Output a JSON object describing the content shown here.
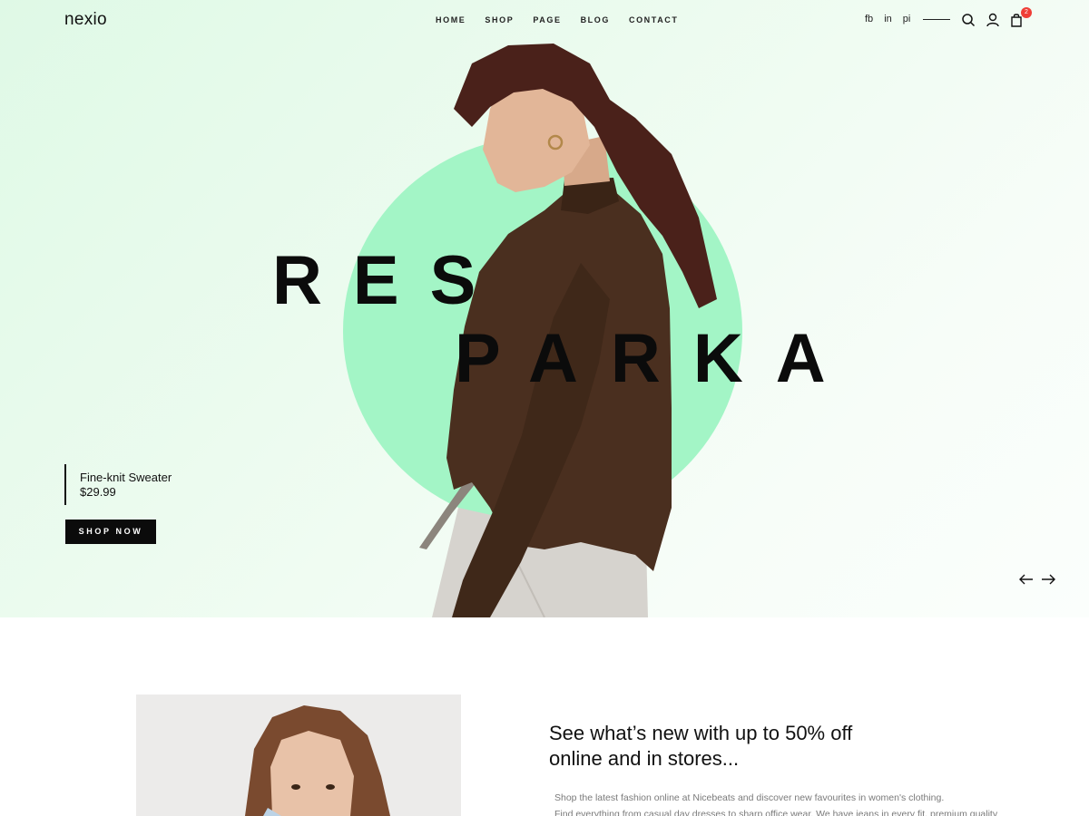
{
  "brand": {
    "logo": "nexio"
  },
  "nav": {
    "items": [
      {
        "label": "HOME"
      },
      {
        "label": "SHOP"
      },
      {
        "label": "PAGE"
      },
      {
        "label": "BLOG"
      },
      {
        "label": "CONTACT"
      }
    ]
  },
  "social": {
    "links": [
      {
        "label": "fb"
      },
      {
        "label": "in"
      },
      {
        "label": "pi"
      }
    ]
  },
  "header_icons": {
    "search": "search-icon",
    "account": "user-icon",
    "cart": "shopping-bag-icon",
    "cart_count": "2"
  },
  "hero": {
    "headline_line1": "RESI",
    "headline_line2": "PARKA",
    "product_name": "Fine-knit Sweater",
    "product_price": "$29.99",
    "cta_label": "SHOP NOW",
    "prev_icon": "arrow-left-icon",
    "next_icon": "arrow-right-icon",
    "accent_color": "#a3f5c6"
  },
  "promo": {
    "title_line1": "See what’s new with up to 50% off",
    "title_line2": "online and in stores...",
    "text_line1": "Shop the latest fashion online at Nicebeats and discover new favourites in women's clothing.",
    "text_line2": "Find everything from casual day dresses to sharp office wear. We have jeans in every fit, premium quality"
  }
}
